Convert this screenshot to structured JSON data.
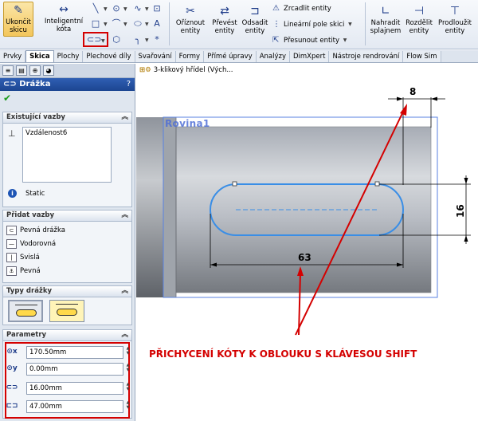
{
  "ribbon": {
    "exit_sketch": "Ukončit skicu",
    "smart_dimension": "Inteligentní kóta",
    "trim": "Oříznout entity",
    "convert": "Převést entity",
    "offset": "Odsadit entity",
    "mirror": "Zrcadlit entity",
    "linear_pattern": "Lineární pole skici",
    "move": "Přesunout entity",
    "replace": "Nahradit splajnem",
    "split": "Rozdělit entity",
    "extend": "Prodloužit entity"
  },
  "tabs": [
    "Prvky",
    "Skica",
    "Plochy",
    "Plechové díly",
    "Svařování",
    "Formy",
    "Přímé úpravy",
    "Analýzy",
    "DimXpert",
    "Nástroje rendrování",
    "Flow Sim"
  ],
  "active_tab": "Skica",
  "panel": {
    "title": "Drážka",
    "help": "?",
    "existing_header": "Existující vazby",
    "existing_items": [
      "Vzdálenost6"
    ],
    "status": "Static",
    "add_header": "Přidat vazby",
    "add_items": [
      "Pevná drážka",
      "Vodorovná",
      "Svislá",
      "Pevná"
    ],
    "types_header": "Typy drážky",
    "params_header": "Parametry",
    "params": [
      "170.50mm",
      "0.00mm",
      "16.00mm",
      "47.00mm"
    ]
  },
  "viewport": {
    "tree_crumb": "3-klikový hřídel (Vých...",
    "plane_label": "Rovina1",
    "dim_top": "8",
    "dim_right": "16",
    "dim_bottom": "63",
    "annotation": "PŘICHYCENÍ KÓTY K OBLOUKU S KLÁVESOU SHIFT"
  },
  "colors": {
    "accent_red": "#d40000",
    "sketch_blue": "#3a8ee6",
    "title_blue": "#1c4591"
  }
}
